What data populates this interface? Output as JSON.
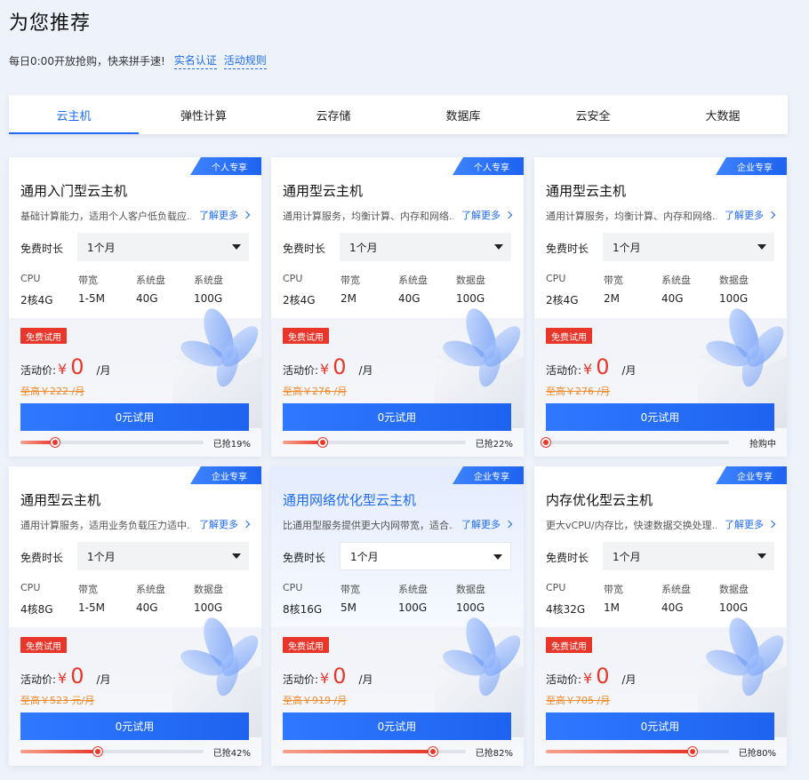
{
  "header": {
    "title": "为您推荐",
    "subtitle": "每日0:00开放抢购，快来拼手速!",
    "link_realname": "实名认证",
    "link_rules": "活动规则"
  },
  "tabs": [
    {
      "label": "云主机",
      "active": true
    },
    {
      "label": "弹性计算",
      "active": false
    },
    {
      "label": "云存储",
      "active": false
    },
    {
      "label": "数据库",
      "active": false
    },
    {
      "label": "云安全",
      "active": false
    },
    {
      "label": "大数据",
      "active": false
    }
  ],
  "common": {
    "learn_more": "了解更多",
    "duration_label": "免费时长",
    "free_tag": "免费试用",
    "price_label": "活动价:",
    "currency": "¥",
    "unit": "/月",
    "try_button": "0元试用"
  },
  "colors": {
    "accent": "#1f6bf2",
    "price": "#e8362b",
    "orig_price": "#f08a2a"
  },
  "cards": [
    {
      "badge": "个人专享",
      "title": "通用入门型云主机",
      "desc": "基础计算能力，适用个人客户低负载应...",
      "duration": "1个月",
      "spec_heads": [
        "CPU",
        "带宽",
        "系统盘",
        "系统盘"
      ],
      "spec_vals": [
        "2核4G",
        "1-5M",
        "40G",
        "100G"
      ],
      "price": "0",
      "orig_price": "至高￥222 /月",
      "progress_text": "已抢19%",
      "progress": 0.19,
      "highlight": false
    },
    {
      "badge": "个人专享",
      "title": "通用型云主机",
      "desc": "通用计算服务，均衡计算、内存和网络...",
      "duration": "1个月",
      "spec_heads": [
        "CPU",
        "带宽",
        "系统盘",
        "数据盘"
      ],
      "spec_vals": [
        "2核4G",
        "2M",
        "40G",
        "100G"
      ],
      "price": "0",
      "orig_price": "至高￥276 /月",
      "progress_text": "已抢22%",
      "progress": 0.22,
      "highlight": false
    },
    {
      "badge": "企业专享",
      "title": "通用型云主机",
      "desc": "通用计算服务，均衡计算、内存和网络...",
      "duration": "1个月",
      "spec_heads": [
        "CPU",
        "带宽",
        "系统盘",
        "数据盘"
      ],
      "spec_vals": [
        "2核4G",
        "2M",
        "40G",
        "100G"
      ],
      "price": "0",
      "orig_price": "至高￥276 /月",
      "progress_text": "抢购中",
      "progress": 0.0,
      "highlight": false
    },
    {
      "badge": "企业专享",
      "title": "通用型云主机",
      "desc": "通用计算服务，适用业务负载压力适中...",
      "duration": "1个月",
      "spec_heads": [
        "CPU",
        "带宽",
        "系统盘",
        "数据盘"
      ],
      "spec_vals": [
        "4核8G",
        "1-5M",
        "40G",
        "100G"
      ],
      "price": "0",
      "orig_price": "至高￥523 元/月",
      "progress_text": "已抢42%",
      "progress": 0.42,
      "highlight": false
    },
    {
      "badge": "企业专享",
      "title": "通用网络优化型云主机",
      "desc": "比通用型服务提供更大内网带宽，适合...",
      "duration": "1个月",
      "spec_heads": [
        "CPU",
        "带宽",
        "系统盘",
        "数据盘"
      ],
      "spec_vals": [
        "8核16G",
        "5M",
        "100G",
        "100G"
      ],
      "price": "0",
      "orig_price": "至高￥919 /月",
      "progress_text": "已抢82%",
      "progress": 0.82,
      "highlight": true
    },
    {
      "badge": "企业专享",
      "title": "内存优化型云主机",
      "desc": "更大vCPU/内存比，快速数据交换处理...",
      "duration": "1个月",
      "spec_heads": [
        "CPU",
        "带宽",
        "系统盘",
        "数据盘"
      ],
      "spec_vals": [
        "4核32G",
        "1M",
        "40G",
        "100G"
      ],
      "price": "0",
      "orig_price": "至高￥705 /月",
      "progress_text": "已抢80%",
      "progress": 0.8,
      "highlight": false
    }
  ]
}
